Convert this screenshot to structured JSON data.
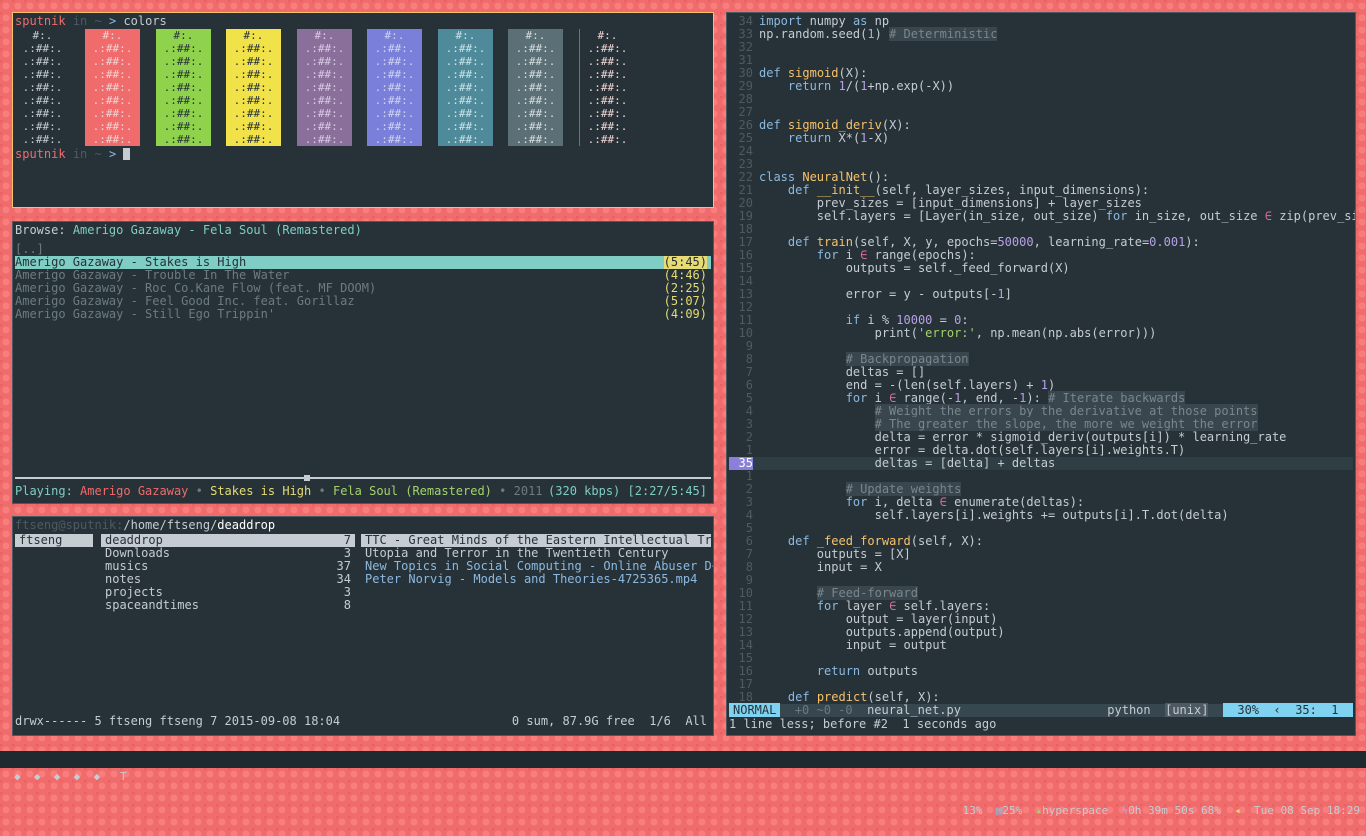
{
  "colors_term": {
    "user": "sputnik",
    "in_word": "in",
    "cwd": "~",
    "arrow": ">",
    "command": "colors",
    "swatch_pattern": [
      " #:. ",
      ".:##:.",
      ".:##:.",
      ".:##:.",
      ".:##:.",
      ".:##:.",
      ".:##:.",
      ".:##:.",
      ".:##:."
    ],
    "swatch_colors": [
      "#263238",
      "#f06b6b",
      "#8fd34c",
      "#f2e24a",
      "#8a6f9a",
      "#7a7fd9",
      "#4e8a9a",
      "#5b7076",
      "#66777e",
      "#263238"
    ],
    "swatch_fg": [
      "#c5ccd2",
      "#f2d4d4",
      "#263238",
      "#263238",
      "#d9c9e6",
      "#d0d4f2",
      "#c8e4ea",
      "#d6dde0",
      "#d6dde0",
      "#f2d4d4"
    ]
  },
  "player": {
    "browse_label": "Browse:",
    "browse_path": "Amerigo Gazaway - Fela Soul (Remastered)",
    "parent": "[..]",
    "tracks": [
      {
        "title": "Amerigo Gazaway - Stakes is High",
        "time": "(5:45)"
      },
      {
        "title": "Amerigo Gazaway - Trouble In The Water",
        "time": "(4:46)"
      },
      {
        "title": "Amerigo Gazaway - Roc Co.Kane Flow (feat. MF DOOM)",
        "time": "(2:25)"
      },
      {
        "title": "Amerigo Gazaway - Feel Good Inc. feat. Gorillaz",
        "time": "(5:07)"
      },
      {
        "title": "Amerigo Gazaway - Still Ego Trippin'",
        "time": "(4:09)"
      }
    ],
    "progress": 0.42,
    "playing_label": "Playing:",
    "artist": "Amerigo Gazaway",
    "sep": "•",
    "song": "Stakes is High",
    "album": "Fela Soul (Remastered)",
    "year": "2011",
    "bitrate": "(320 kbps)",
    "elapsed": "[2:27/5:45]"
  },
  "ranger": {
    "host": "ftseng@sputnik:",
    "path_prefix": "/home/ftseng/",
    "path_current": "deaddrop",
    "parent_col": [
      "ftseng"
    ],
    "dirs": [
      {
        "name": "deaddrop",
        "count": "7"
      },
      {
        "name": "Downloads",
        "count": "3"
      },
      {
        "name": "musics",
        "count": "37"
      },
      {
        "name": "notes",
        "count": "34"
      },
      {
        "name": "projects",
        "count": "3"
      },
      {
        "name": "spaceandtimes",
        "count": "8"
      }
    ],
    "preview": [
      "TTC - Great Minds of the Eastern Intellectual Tr~",
      "Utopia and Terror in the Twentieth Century",
      "New Topics in Social Computing - Online Abuser D~",
      "Peter Norvig - Models and Theories-4725365.mp4"
    ],
    "status_left": "drwx------ 5 ftseng ftseng 7 2015-09-08 18:04",
    "status_right": "0 sum, 87.9G free  1/6  All"
  },
  "vim": {
    "statusline": {
      "mode": "NORMAL",
      "git": "+0 ~0 -0",
      "file": "neural_net.py",
      "filetype": "python",
      "format": "[unix]",
      "percent": "30%",
      "sep": "‹",
      "position": "35:  1"
    },
    "message": "1 line less; before #2  1 seconds ago"
  },
  "bar": {
    "workspaces": "◆  ◆  ◆  ◆  ◆   T",
    "cpu": "13%",
    "mem": "25%",
    "net": "hyperspace",
    "battery": "0h 39m 50s 68%",
    "clock": "Tue 08 Sep 18:29"
  }
}
